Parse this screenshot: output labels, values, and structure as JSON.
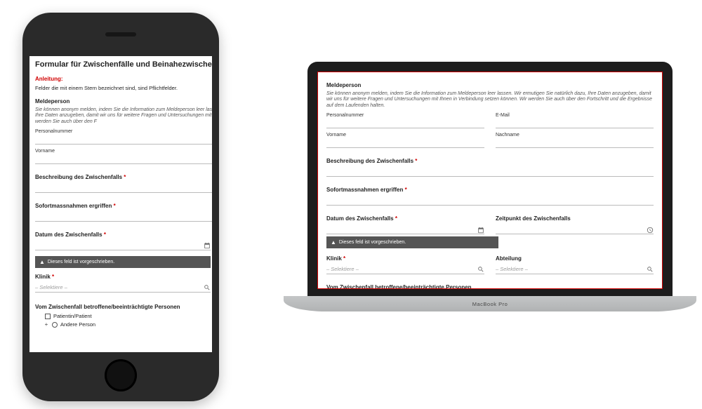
{
  "form": {
    "title": "Formular für Zwischenfälle und Beinahezwischenfälle",
    "instruction_label": "Anleitung:",
    "instruction_text": "Felder die mit einem Stern bezeichnet sind, sind Pflichtfelder.",
    "sections": {
      "reporter": {
        "heading": "Meldeperson",
        "help_full": "Sie können anonym melden, indem Sie die Information zum Meldeperson leer lassen. Wir ermutigen Sie natürlich dazu, Ihre Daten anzugeben, damit wir uns für weitere Fragen und Untersuchungen mit Ihnen in Verbindung setzen können. Wir werden Sie auch über den Fortschritt und die Ergebnisse auf dem Laufenden halten.",
        "help_phone": "Sie können anonym melden, indem Sie die Information zum Meldeperson leer lassen. Wir ermutigen Sie natürlich dazu, Ihre Daten anzugeben, damit wir uns für weitere Fragen und Untersuchungen mit Ihnen in Verbindung setzen können. Wir werden Sie auch über den F",
        "fields": {
          "personnel_no": "Personalnummer",
          "email": "E-Mail",
          "firstname": "Vorname",
          "lastname": "Nachname"
        }
      },
      "description": {
        "heading": "Beschreibung des Zwischenfalls"
      },
      "measures": {
        "heading": "Sofortmassnahmen ergriffen"
      },
      "date": {
        "heading": "Datum des Zwischenfalls"
      },
      "time": {
        "heading": "Zeitpunkt des Zwischenfalls"
      },
      "clinic": {
        "heading": "Klinik",
        "placeholder": "– Selektiere –"
      },
      "department": {
        "heading": "Abteilung",
        "placeholder": "– Selektiere –"
      },
      "affected": {
        "heading": "Vom Zwischenfall betroffene/beeinträchtigte Personen",
        "opt_patient": "Patientin/Patient",
        "opt_other": "Andere Person"
      }
    },
    "validation": {
      "required_msg": "Dieses feld ist vorgeschrieben."
    }
  },
  "macbook": {
    "base_label": "MacBook Pro"
  }
}
